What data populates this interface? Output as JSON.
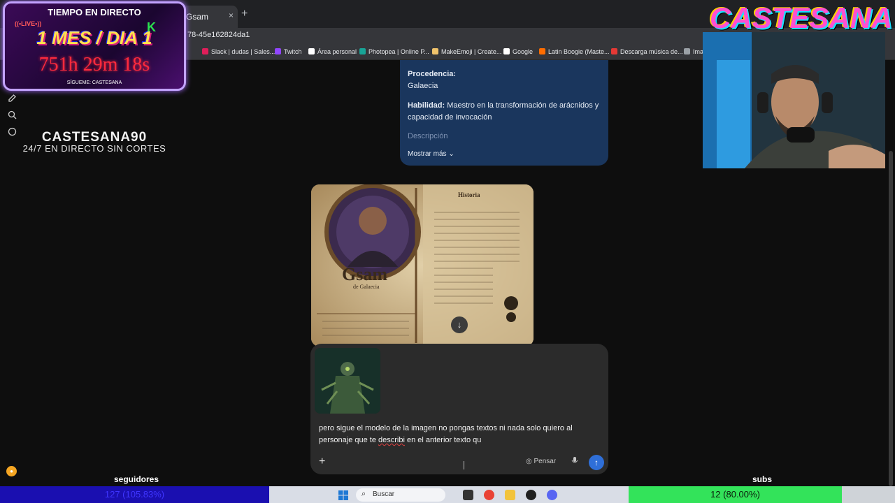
{
  "browser": {
    "tab_title": "Gsam",
    "tab_close": "×",
    "new_tab": "+",
    "window_close": "✕",
    "url": "78-45e162824da1",
    "bookmarks": [
      {
        "label": "Slack | dudas | Sales...",
        "color": "#e01e5a"
      },
      {
        "label": "Twitch",
        "color": "#9146ff"
      },
      {
        "label": "Área personal",
        "color": "#ffffff"
      },
      {
        "label": "Photopea | Online P...",
        "color": "#18a497"
      },
      {
        "label": "MakeEmoji | Create...",
        "color": "#f0c36b"
      },
      {
        "label": "Google",
        "color": "#ffffff"
      },
      {
        "label": "Latin Boogie (Maste...",
        "color": "#ff6d00"
      },
      {
        "label": "Descarga música de...",
        "color": "#e53935"
      },
      {
        "label": "Imag",
        "color": "#9aa0a6"
      }
    ]
  },
  "info_card": {
    "procedencia_label": "Procedencia:",
    "procedencia_value": "Galaecia",
    "habilidad_label": "Habilidad:",
    "habilidad_value": "Maestro en la transformación de arácnidos y capacidad de invocación",
    "descripcion_label": "Descripción",
    "show_more": "Mostrar más"
  },
  "character_sheet": {
    "name": "Gsam",
    "subtitle": "de Galaecia",
    "section": "Historia"
  },
  "composer": {
    "prompt_before": "pero sigue el modelo de la imagen no pongas textos ni nada solo quiero al personaje que te ",
    "prompt_misspelled": "describi",
    "prompt_after": " en el anterior texto qu",
    "think_label": "Pensar",
    "add": "+",
    "send": "↑"
  },
  "overlay": {
    "timer_title": "TIEMPO EN DIRECTO",
    "live_badge": "((•LIVE•))",
    "month_day": "1 MES / DIA 1",
    "kick_logo": "K",
    "countdown": "751h 29m 18s",
    "follow_text": "SÍGUEME: CASTESANA",
    "channel_name": "CASTESANA90",
    "channel_tagline": "24/7 EN DIRECTO SIN CORTES",
    "cam_logo": "CASTESANA"
  },
  "stats": {
    "followers_label": "seguidores",
    "followers_value": "127 (105.83%)",
    "subs_label": "subs",
    "subs_value": "12 (80.00%)"
  },
  "taskbar": {
    "search_placeholder": "Buscar"
  },
  "colors": {
    "info_card_bg": "#1a365d",
    "send_button": "#2f6fd8",
    "followers_bar": "#1a0fb0",
    "subs_bar": "#33e35a"
  }
}
